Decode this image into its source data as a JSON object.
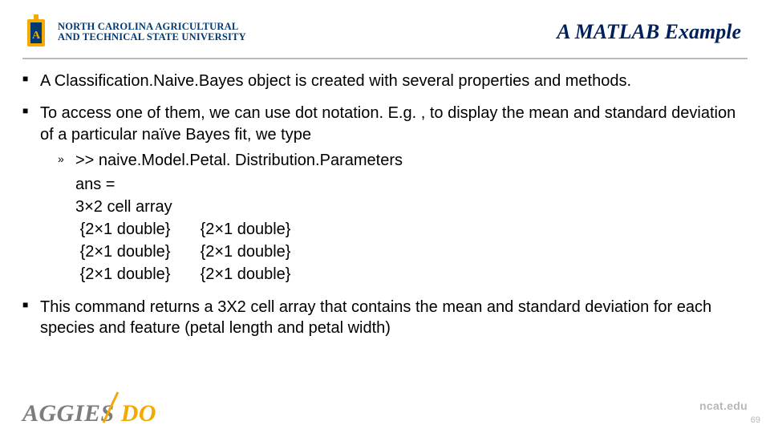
{
  "header": {
    "university": {
      "line1": "NORTH CAROLINA AGRICULTURAL",
      "line2": "AND TECHNICAL STATE UNIVERSITY"
    },
    "title": "A MATLAB Example"
  },
  "bullets": {
    "b1": "A Classification.Naive.Bayes object is created with several properties and methods.",
    "b2": "To access one of them, we can use dot notation. E.g. , to display the mean and standard deviation of a particular naïve Bayes fit, we type",
    "cmd": ">> naive.Model.Petal. Distribution.Parameters",
    "out1": "ans =",
    "out2": "3×2 cell array",
    "cell": "{2×1 double}",
    "b3": "This command returns a 3X2 cell array that contains the mean and standard deviation for each species and feature (petal length and petal width)"
  },
  "footer": {
    "aggies_a": "AGGIES",
    "aggies_b": "DO",
    "url": "ncat.edu",
    "page": "69"
  }
}
